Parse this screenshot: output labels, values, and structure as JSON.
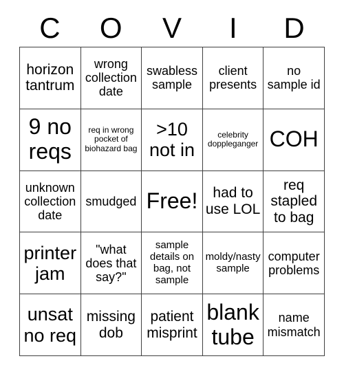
{
  "card": {
    "title_letters": [
      "C",
      "O",
      "V",
      "I",
      "D"
    ],
    "columns": 5,
    "rows": 5,
    "free_space": "Free!",
    "colors": {
      "background": "#ffffff",
      "text": "#000000",
      "grid_line": "#3f3f3f"
    },
    "cells": [
      {
        "text": "horizon tantrum",
        "size": "lg"
      },
      {
        "text": "wrong collection date",
        "size": "md"
      },
      {
        "text": "swabless sample",
        "size": "md"
      },
      {
        "text": "client presents",
        "size": "md"
      },
      {
        "text": "no sample id",
        "size": "md"
      },
      {
        "text": "9 no reqs",
        "size": "xxl"
      },
      {
        "text": "req in wrong pocket of biohazard bag",
        "size": "xs"
      },
      {
        "text": ">10 not in",
        "size": "xl"
      },
      {
        "text": "celebrity doppleganger",
        "size": "xs"
      },
      {
        "text": "COH",
        "size": "xxl"
      },
      {
        "text": "unknown collection date",
        "size": "md"
      },
      {
        "text": "smudged",
        "size": "md"
      },
      {
        "text": "Free!",
        "size": "xxl"
      },
      {
        "text": "had to use LOL",
        "size": "lg"
      },
      {
        "text": "req stapled to bag",
        "size": "lg"
      },
      {
        "text": "printer jam",
        "size": "xl"
      },
      {
        "text": "\"what does that say?\"",
        "size": "md"
      },
      {
        "text": "sample details on bag, not sample",
        "size": "sm"
      },
      {
        "text": "moldy/nasty sample",
        "size": "sm"
      },
      {
        "text": "computer problems",
        "size": "md"
      },
      {
        "text": "unsat no req",
        "size": "xl"
      },
      {
        "text": "missing dob",
        "size": "lg"
      },
      {
        "text": "patient misprint",
        "size": "lg"
      },
      {
        "text": "blank tube",
        "size": "xxl"
      },
      {
        "text": "name mismatch",
        "size": "md"
      }
    ]
  }
}
